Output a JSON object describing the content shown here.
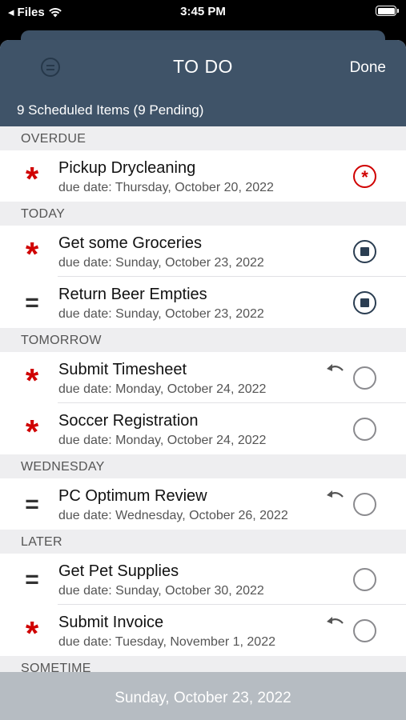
{
  "status_bar": {
    "back_app": "Files",
    "time": "3:45 PM"
  },
  "nav": {
    "title": "TO DO",
    "done_label": "Done",
    "summary": "9 Scheduled Items (9 Pending)"
  },
  "sections": [
    {
      "header": "OVERDUE",
      "items": [
        {
          "priority": "high",
          "title": "Pickup Drycleaning",
          "due": "due date: Thursday, October 20, 2022",
          "status": "overdue",
          "undo": false
        }
      ]
    },
    {
      "header": "TODAY",
      "items": [
        {
          "priority": "high",
          "title": "Get some Groceries",
          "due": "due date: Sunday, October 23, 2022",
          "status": "in-progress",
          "undo": false
        },
        {
          "priority": "normal",
          "title": "Return Beer Empties",
          "due": "due date: Sunday, October 23, 2022",
          "status": "in-progress",
          "undo": false
        }
      ]
    },
    {
      "header": "TOMORROW",
      "items": [
        {
          "priority": "high",
          "title": "Submit Timesheet",
          "due": "due date: Monday, October 24, 2022",
          "status": "pending",
          "undo": true
        },
        {
          "priority": "high",
          "title": "Soccer Registration",
          "due": "due date: Monday, October 24, 2022",
          "status": "pending",
          "undo": false
        }
      ]
    },
    {
      "header": "WEDNESDAY",
      "items": [
        {
          "priority": "normal",
          "title": "PC Optimum Review",
          "due": "due date: Wednesday, October 26, 2022",
          "status": "pending",
          "undo": true
        }
      ]
    },
    {
      "header": "LATER",
      "items": [
        {
          "priority": "normal",
          "title": "Get Pet Supplies",
          "due": "due date: Sunday, October 30, 2022",
          "status": "pending",
          "undo": false
        },
        {
          "priority": "high",
          "title": "Submit Invoice",
          "due": "due date: Tuesday, November 1, 2022",
          "status": "pending",
          "undo": true
        }
      ]
    },
    {
      "header": "SOMETIME",
      "items": []
    }
  ],
  "bottom_bar": {
    "date": "Sunday, October 23, 2022"
  },
  "icons": {
    "high_priority": "asterisk-icon",
    "normal_priority": "equals-icon",
    "undo": "undo-arrow-icon",
    "menu": "menu-circle-icon"
  },
  "colors": {
    "nav_bg": "#3f5368",
    "high_priority": "#d00000",
    "bottom_bar_bg": "#b6bcc2"
  }
}
